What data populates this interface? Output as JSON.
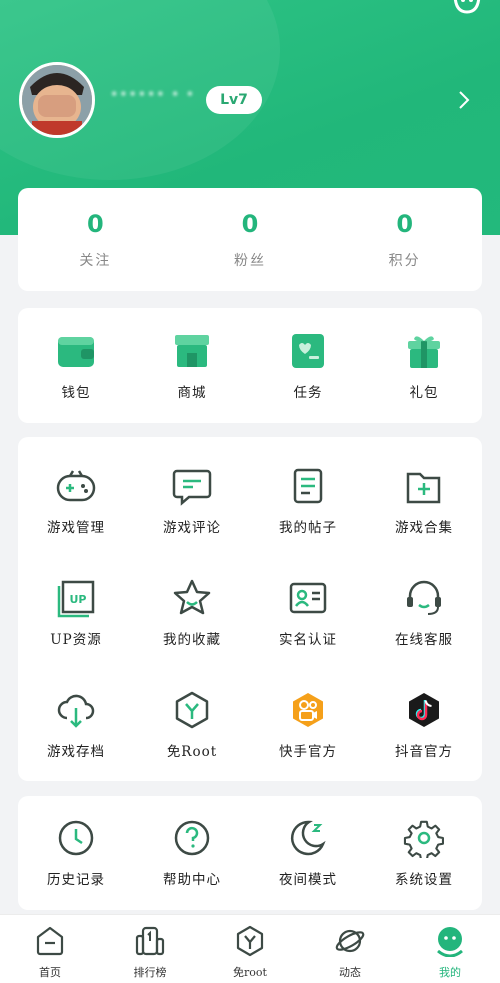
{
  "profile": {
    "username": "•••••• • •",
    "level": "Lv7"
  },
  "stats": [
    {
      "value": "0",
      "label": "关注"
    },
    {
      "value": "0",
      "label": "粉丝"
    },
    {
      "value": "0",
      "label": "积分"
    }
  ],
  "quick_actions": [
    {
      "label": "钱包",
      "icon": "wallet-icon"
    },
    {
      "label": "商城",
      "icon": "shop-icon"
    },
    {
      "label": "任务",
      "icon": "task-icon"
    },
    {
      "label": "礼包",
      "icon": "gift-icon"
    }
  ],
  "features": [
    {
      "label": "游戏管理",
      "icon": "gamepad-icon"
    },
    {
      "label": "游戏评论",
      "icon": "comment-icon"
    },
    {
      "label": "我的帖子",
      "icon": "posts-icon"
    },
    {
      "label": "游戏合集",
      "icon": "collection-folder-icon"
    },
    {
      "label": "UP资源",
      "icon": "up-resource-icon"
    },
    {
      "label": "我的收藏",
      "icon": "star-icon"
    },
    {
      "label": "实名认证",
      "icon": "id-card-icon"
    },
    {
      "label": "在线客服",
      "icon": "headset-icon"
    },
    {
      "label": "游戏存档",
      "icon": "cloud-download-icon"
    },
    {
      "label": "免Root",
      "icon": "no-root-icon"
    },
    {
      "label": "快手官方",
      "icon": "kuaishou-icon"
    },
    {
      "label": "抖音官方",
      "icon": "douyin-icon"
    }
  ],
  "tools": [
    {
      "label": "历史记录",
      "icon": "clock-icon"
    },
    {
      "label": "帮助中心",
      "icon": "help-icon"
    },
    {
      "label": "夜间模式",
      "icon": "moon-icon"
    },
    {
      "label": "系统设置",
      "icon": "gear-icon"
    }
  ],
  "tabs": [
    {
      "label": "首页",
      "icon": "home-icon"
    },
    {
      "label": "排行榜",
      "icon": "ranking-icon"
    },
    {
      "label": "免root",
      "icon": "no-root-icon"
    },
    {
      "label": "动态",
      "icon": "planet-icon"
    },
    {
      "label": "我的",
      "icon": "profile-icon",
      "active": true
    }
  ],
  "colors": {
    "brand": "#23b57c",
    "icon_stroke": "#3d4a45",
    "kuaishou": "#f5a01a",
    "douyin": "#1a1a1a"
  }
}
